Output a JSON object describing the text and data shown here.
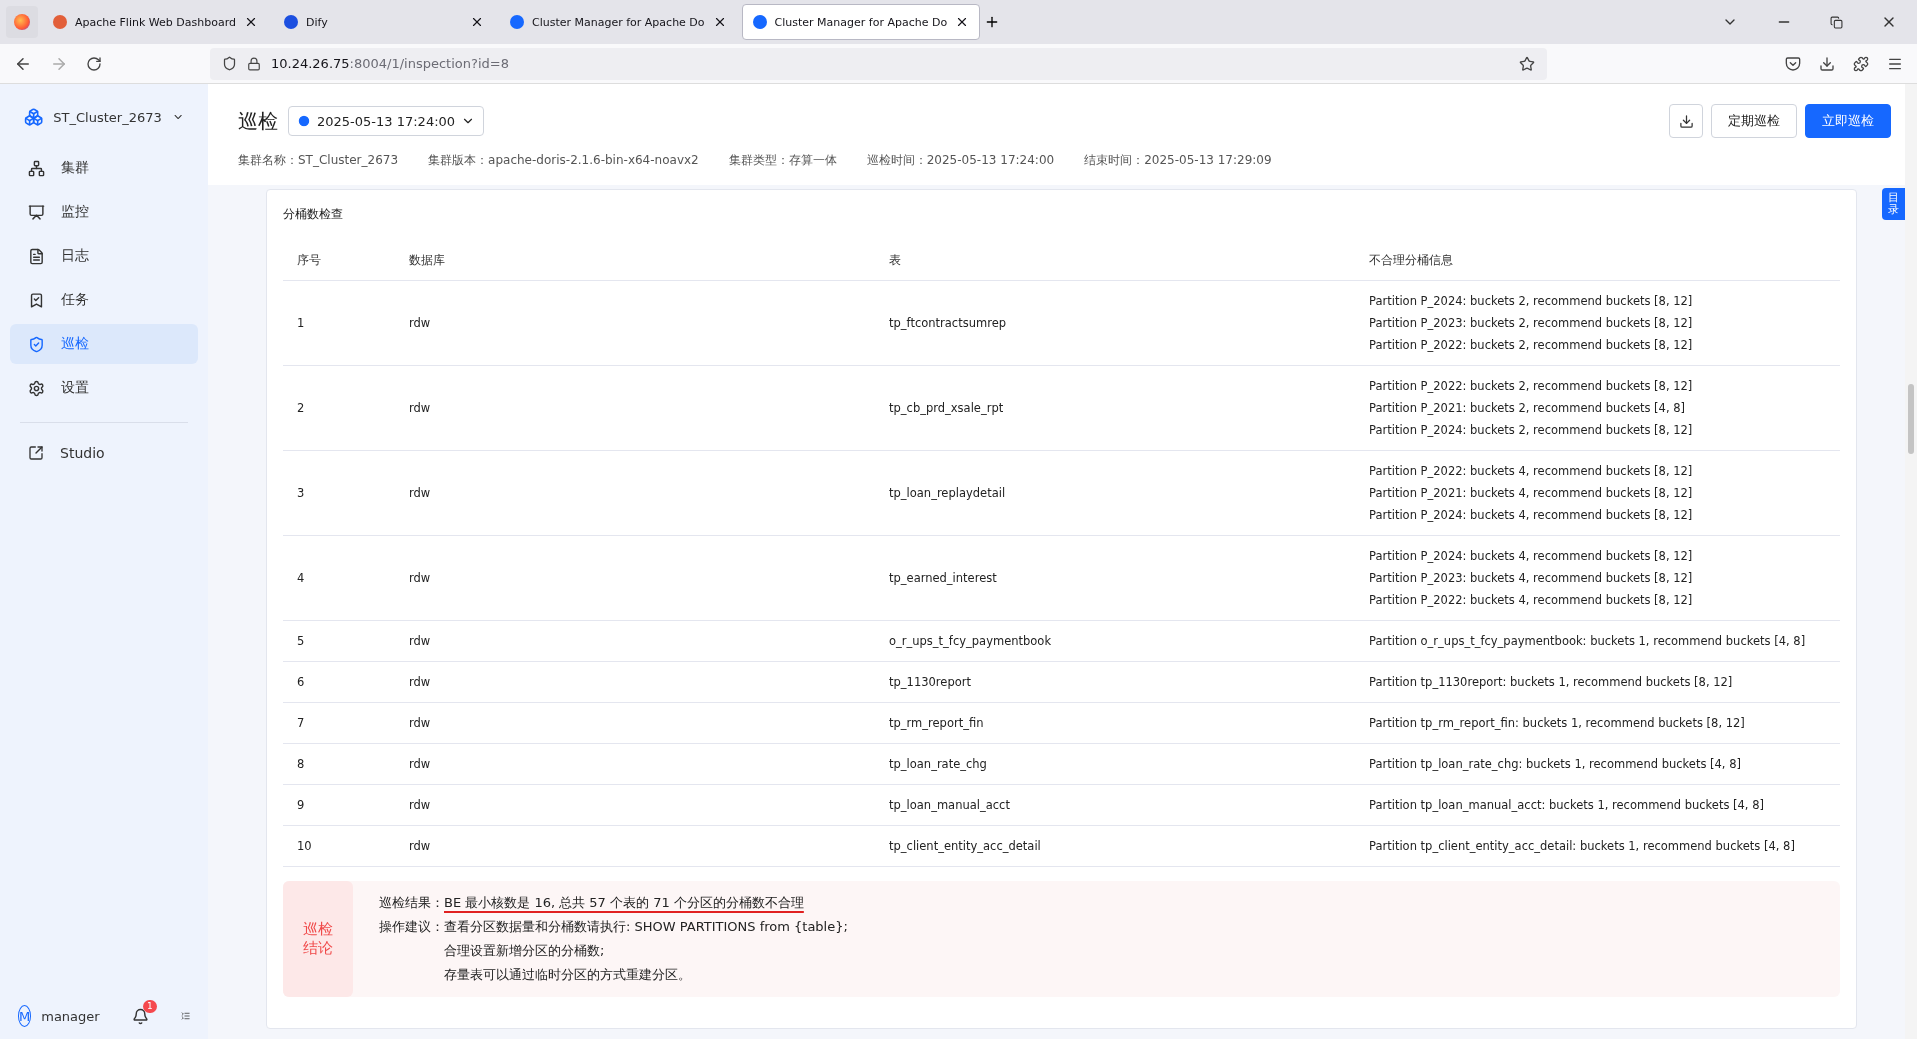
{
  "browser": {
    "tabs": [
      {
        "title": "Apache Flink Web Dashboard",
        "selected": false
      },
      {
        "title": "Dify",
        "selected": false
      },
      {
        "title": "Cluster Manager for Apache Do",
        "selected": false
      },
      {
        "title": "Cluster Manager for Apache Do",
        "selected": true
      }
    ],
    "url": {
      "host": "10.24.26.75",
      "path": ":8004/1/inspection?id=8"
    }
  },
  "sidebar": {
    "cluster": "ST_Cluster_2673",
    "items": [
      {
        "label": "集群",
        "selected": false
      },
      {
        "label": "监控",
        "selected": false
      },
      {
        "label": "日志",
        "selected": false
      },
      {
        "label": "任务",
        "selected": false
      },
      {
        "label": "巡检",
        "selected": true
      },
      {
        "label": "设置",
        "selected": false
      }
    ],
    "studio": "Studio",
    "user_initial": "M",
    "user": "manager",
    "notifications": "1"
  },
  "header": {
    "title": "巡检",
    "date": "2025-05-13 17:24:00",
    "meta": [
      {
        "label": "集群名称：",
        "value": "ST_Cluster_2673"
      },
      {
        "label": "集群版本：",
        "value": "apache-doris-2.1.6-bin-x64-noavx2"
      },
      {
        "label": "集群类型：",
        "value": "存算一体"
      },
      {
        "label": "巡检时间：",
        "value": "2025-05-13 17:24:00"
      },
      {
        "label": "结束时间：",
        "value": "2025-05-13 17:29:09"
      }
    ],
    "schedule_button": "定期巡检",
    "run_button": "立即巡检"
  },
  "toc_tab": "目录",
  "section": {
    "title": "分桶数检查",
    "columns": [
      "序号",
      "数据库",
      "表",
      "不合理分桶信息"
    ],
    "rows": [
      {
        "no": "1",
        "database": "rdw",
        "table": "tp_ftcontractsumrep",
        "issues": [
          "Partition P_2024: buckets 2, recommend buckets [8, 12]",
          "Partition P_2023: buckets 2, recommend buckets [8, 12]",
          "Partition P_2022: buckets 2, recommend buckets [8, 12]"
        ]
      },
      {
        "no": "2",
        "database": "rdw",
        "table": "tp_cb_prd_xsale_rpt",
        "issues": [
          "Partition P_2022: buckets 2, recommend buckets [8, 12]",
          "Partition P_2021: buckets 2, recommend buckets [4, 8]",
          "Partition P_2024: buckets 2, recommend buckets [8, 12]"
        ]
      },
      {
        "no": "3",
        "database": "rdw",
        "table": "tp_loan_replaydetail",
        "issues": [
          "Partition P_2022: buckets 4, recommend buckets [8, 12]",
          "Partition P_2021: buckets 4, recommend buckets [8, 12]",
          "Partition P_2024: buckets 4, recommend buckets [8, 12]"
        ]
      },
      {
        "no": "4",
        "database": "rdw",
        "table": "tp_earned_interest",
        "issues": [
          "Partition P_2024: buckets 4, recommend buckets [8, 12]",
          "Partition P_2023: buckets 4, recommend buckets [8, 12]",
          "Partition P_2022: buckets 4, recommend buckets [8, 12]"
        ]
      },
      {
        "no": "5",
        "database": "rdw",
        "table": "o_r_ups_t_fcy_paymentbook",
        "issues": [
          "Partition o_r_ups_t_fcy_paymentbook: buckets 1, recommend buckets [4, 8]"
        ]
      },
      {
        "no": "6",
        "database": "rdw",
        "table": "tp_1130report",
        "issues": [
          "Partition tp_1130report: buckets 1, recommend buckets [8, 12]"
        ]
      },
      {
        "no": "7",
        "database": "rdw",
        "table": "tp_rm_report_fin",
        "issues": [
          "Partition tp_rm_report_fin: buckets 1, recommend buckets [8, 12]"
        ]
      },
      {
        "no": "8",
        "database": "rdw",
        "table": "tp_loan_rate_chg",
        "issues": [
          "Partition tp_loan_rate_chg: buckets 1, recommend buckets [4, 8]"
        ]
      },
      {
        "no": "9",
        "database": "rdw",
        "table": "tp_loan_manual_acct",
        "issues": [
          "Partition tp_loan_manual_acct: buckets 1, recommend buckets [4, 8]"
        ]
      },
      {
        "no": "10",
        "database": "rdw",
        "table": "tp_client_entity_acc_detail",
        "issues": [
          "Partition tp_client_entity_acc_detail: buckets 1, recommend buckets [4, 8]"
        ]
      }
    ]
  },
  "conclusion": {
    "badge": [
      "巡检",
      "结论"
    ],
    "result_label": "巡检结果：",
    "result": "BE 最小核数是 16, 总共 57 个表的 71 个分区的分桶数不合理",
    "advice_label": "操作建议：",
    "advice": [
      "查看分区数据量和分桶数请执行: SHOW PARTITIONS from {table};",
      "合理设置新增分区的分桶数;",
      "存量表可以通过临时分区的方式重建分区。"
    ]
  }
}
